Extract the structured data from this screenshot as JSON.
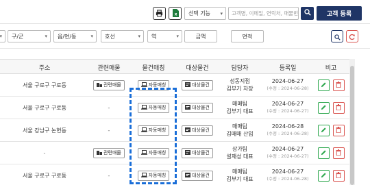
{
  "toolbar": {
    "function_select": "선택 기능",
    "search_placeholder": "고객명, 이메일, 연락처, 매물번호",
    "add_customer_label": "고객 등록"
  },
  "filters": {
    "district": "구/군",
    "dong": "읍/면/동",
    "line": "호선",
    "station": "역",
    "price": "금액",
    "area": "면적"
  },
  "columns": {
    "address": "주소",
    "related": "관련매물",
    "matching": "물건매칭",
    "target": "대상물건",
    "manager": "담당자",
    "registered": "등록일",
    "note": "비고"
  },
  "labels": {
    "related_btn": "관련매물",
    "auto_match_btn": "자동매칭",
    "target_btn": "대상물건"
  },
  "rows": [
    {
      "address": "서울 구로구 구로동",
      "related": "btn",
      "manager_team": "성동지점",
      "manager_name": "김부기 차장",
      "date": "2024-06-27",
      "date_sub": "(수정 : 2024-06-28)"
    },
    {
      "address": "서울 구로구 구로동",
      "related": "-",
      "manager_team": "매매팀",
      "manager_name": "김부기 대표",
      "date": "2024-06-27",
      "date_sub": "(수정 : 2024-06-27)"
    },
    {
      "address": "서울 강남구 논현동",
      "related": "-",
      "manager_team": "매매팀",
      "manager_name": "김매매 산입",
      "date": "2024-06-28",
      "date_sub": "(수정 : 2024-06-28)"
    },
    {
      "address": "-",
      "related": "btn",
      "manager_team": "상가팀",
      "manager_name": "설재성 대표",
      "date": "2024-06-27",
      "date_sub": "(수정 : 2024-06-27)"
    },
    {
      "address": "서울 구로구 구로동",
      "related": "-",
      "manager_team": "매매팀",
      "manager_name": "김부기 대표",
      "date": "2024-06-27",
      "date_sub": "(수정 : 2024-06-28)"
    }
  ],
  "colors": {
    "navy": "#1f3566",
    "highlight": "#1a6ed8",
    "edit": "#2fa84f",
    "delete": "#d9534f"
  }
}
